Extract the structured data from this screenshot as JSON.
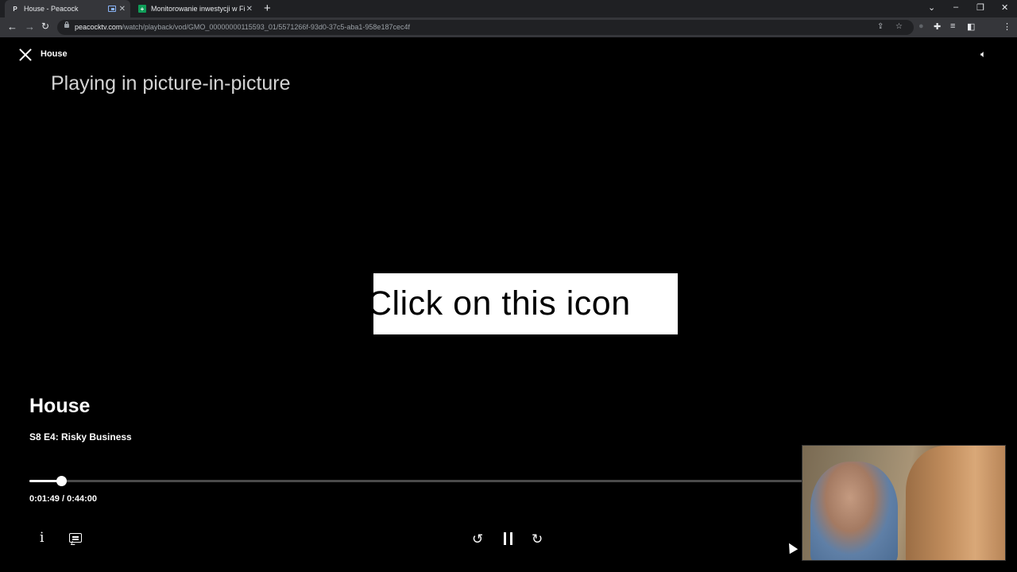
{
  "browser": {
    "tabs": [
      {
        "title": "House - Peacock",
        "favicon": "P",
        "active": true
      },
      {
        "title": "Monitorowanie inwestycji w Fina",
        "favicon": "+",
        "active": false
      }
    ],
    "url_host": "peacocktv.com",
    "url_path": "/watch/playback/vod/GMO_00000000115593_01/5571266f-93d0-37c5-aba1-958e187cec4f"
  },
  "player": {
    "top_title": "House",
    "pip_message": "Playing in picture-in-picture",
    "overlay_text": "Click on this icon",
    "show_title": "House",
    "episode": "S8 E4: Risky Business",
    "time_display": "0:01:49 / 0:44:00",
    "progress_fraction": 0.0413
  },
  "colors": {
    "tabstrip": "#1f2023",
    "toolbar": "#35363a",
    "background": "#000000"
  }
}
